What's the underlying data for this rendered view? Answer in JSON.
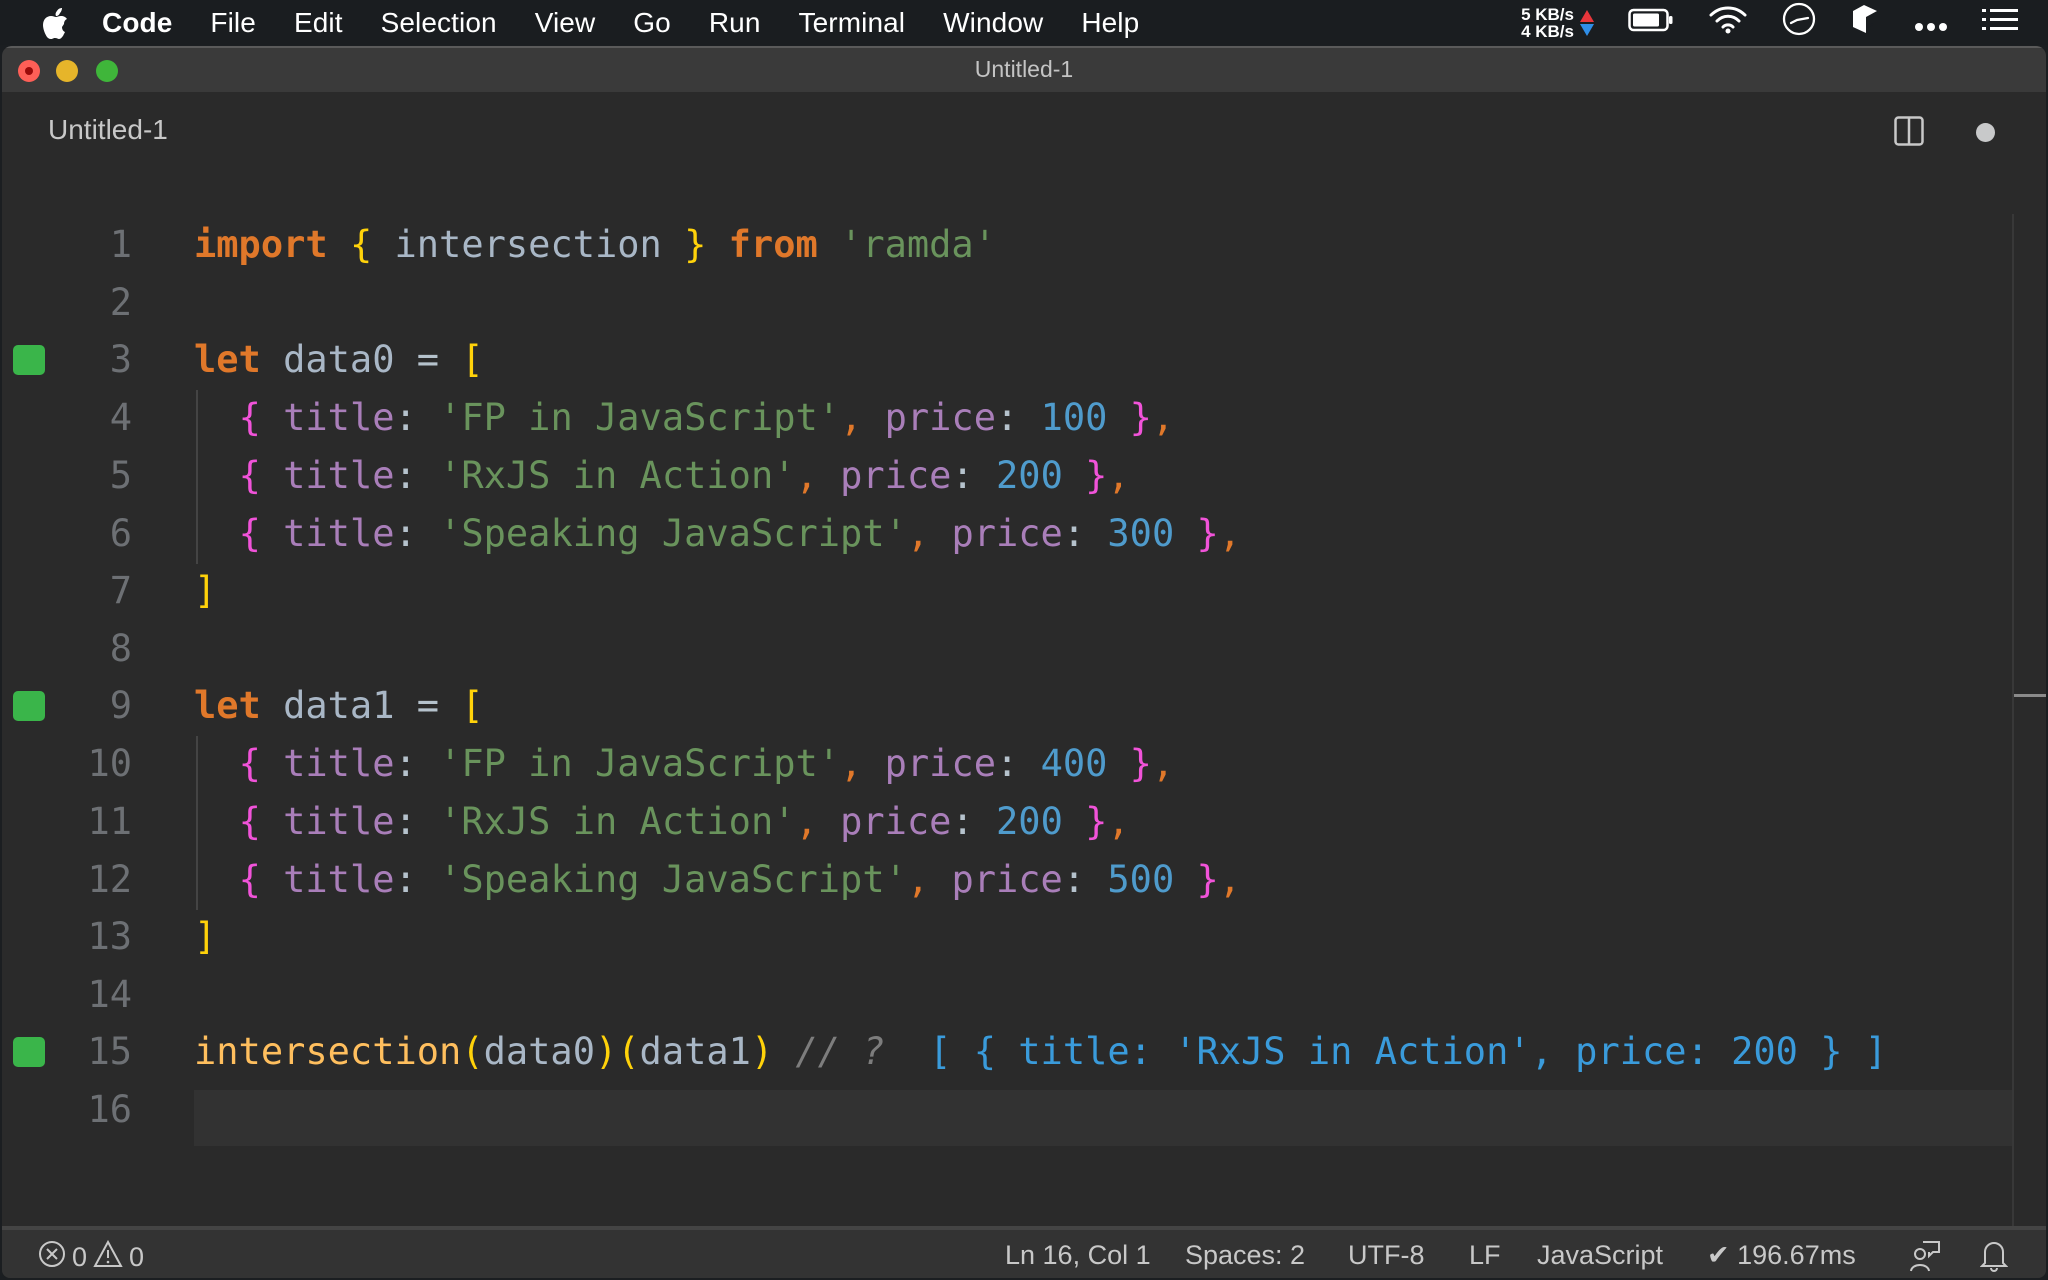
{
  "menubar": {
    "app_name": "Code",
    "items": [
      "File",
      "Edit",
      "Selection",
      "View",
      "Go",
      "Run",
      "Terminal",
      "Window",
      "Help"
    ],
    "net_up": "5 KB/s",
    "net_down": "4 KB/s",
    "status_icons": [
      "battery-icon",
      "wifi-icon",
      "clock-icon",
      "app-icon",
      "more-icon",
      "list-icon"
    ]
  },
  "window": {
    "title": "Untitled-1"
  },
  "tab": {
    "label": "Untitled-1",
    "split_editor_icon": "split-editor-icon",
    "unsaved_indicator": "dirty-dot"
  },
  "editor": {
    "line_numbers": [
      "1",
      "2",
      "3",
      "4",
      "5",
      "6",
      "7",
      "8",
      "9",
      "10",
      "11",
      "12",
      "13",
      "14",
      "15",
      "16"
    ],
    "coverage_marks": [
      3,
      9,
      15
    ],
    "current_line": 16,
    "code": {
      "l1": {
        "kw1": "import",
        "ob": "{",
        "name": "intersection",
        "cb": "}",
        "kw2": "from",
        "str": "'ramda'"
      },
      "l3": {
        "kw": "let",
        "name": "data0",
        "eq": "=",
        "br": "["
      },
      "l4": {
        "title_key": "title",
        "title": "'FP in JavaScript'",
        "price_key": "price",
        "price": "100"
      },
      "l5": {
        "title_key": "title",
        "title": "'RxJS in Action'",
        "price_key": "price",
        "price": "200"
      },
      "l6": {
        "title_key": "title",
        "title": "'Speaking JavaScript'",
        "price_key": "price",
        "price": "300"
      },
      "l7": {
        "br": "]"
      },
      "l9": {
        "kw": "let",
        "name": "data1",
        "eq": "=",
        "br": "["
      },
      "l10": {
        "title_key": "title",
        "title": "'FP in JavaScript'",
        "price_key": "price",
        "price": "400"
      },
      "l11": {
        "title_key": "title",
        "title": "'RxJS in Action'",
        "price_key": "price",
        "price": "200"
      },
      "l12": {
        "title_key": "title",
        "title": "'Speaking JavaScript'",
        "price_key": "price",
        "price": "500"
      },
      "l13": {
        "br": "]"
      },
      "l15": {
        "fn": "intersection",
        "arg1": "data0",
        "arg2": "data1",
        "comment": "// ?",
        "result": "[ { title: 'RxJS in Action', price: 200 } ]"
      }
    }
  },
  "statusbar": {
    "errors": "0",
    "warnings": "0",
    "cursor": "Ln 16, Col 1",
    "indent": "Spaces: 2",
    "encoding": "UTF-8",
    "eol": "LF",
    "language": "JavaScript",
    "timing": "✔ 196.67ms"
  }
}
